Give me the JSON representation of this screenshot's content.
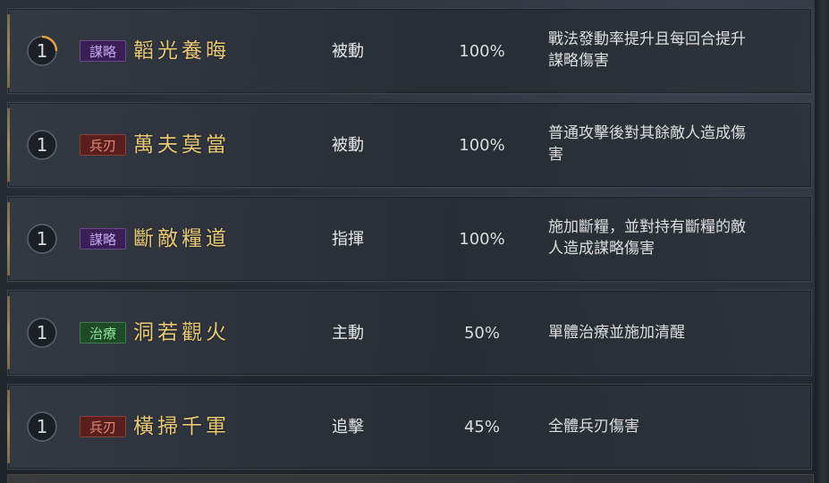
{
  "colors": {
    "tag_strategy_bg": "#3a1f56",
    "tag_strategy_text": "#c6a6ee",
    "tag_weapon_bg": "#5a1f1c",
    "tag_weapon_text": "#e08c7c",
    "tag_heal_bg": "#1e4a26",
    "tag_heal_text": "#8ee09a",
    "name_gold": "#e7c877",
    "ring_accent": "#e3a13a"
  },
  "skills": [
    {
      "level": "1",
      "tag": "謀略",
      "tag_kind": "strategy",
      "name": "韜光養晦",
      "type": "被動",
      "rate": "100%",
      "desc": "戰法發動率提升且每回合提升\n謀略傷害",
      "ring_progress": 0.25
    },
    {
      "level": "1",
      "tag": "兵刃",
      "tag_kind": "weapon",
      "name": "萬夫莫當",
      "type": "被動",
      "rate": "100%",
      "desc": "普通攻擊後對其餘敵人造成傷\n害",
      "ring_progress": 0
    },
    {
      "level": "1",
      "tag": "謀略",
      "tag_kind": "strategy",
      "name": "斷敵糧道",
      "type": "指揮",
      "rate": "100%",
      "desc": "施加斷糧，並對持有斷糧的敵\n人造成謀略傷害",
      "ring_progress": 0
    },
    {
      "level": "1",
      "tag": "治療",
      "tag_kind": "heal",
      "name": "洞若觀火",
      "type": "主動",
      "rate": "50%",
      "desc": "單體治療並施加清醒",
      "ring_progress": 0
    },
    {
      "level": "1",
      "tag": "兵刃",
      "tag_kind": "weapon",
      "name": "橫掃千軍",
      "type": "追擊",
      "rate": "45%",
      "desc": "全體兵刃傷害",
      "ring_progress": 0
    }
  ]
}
